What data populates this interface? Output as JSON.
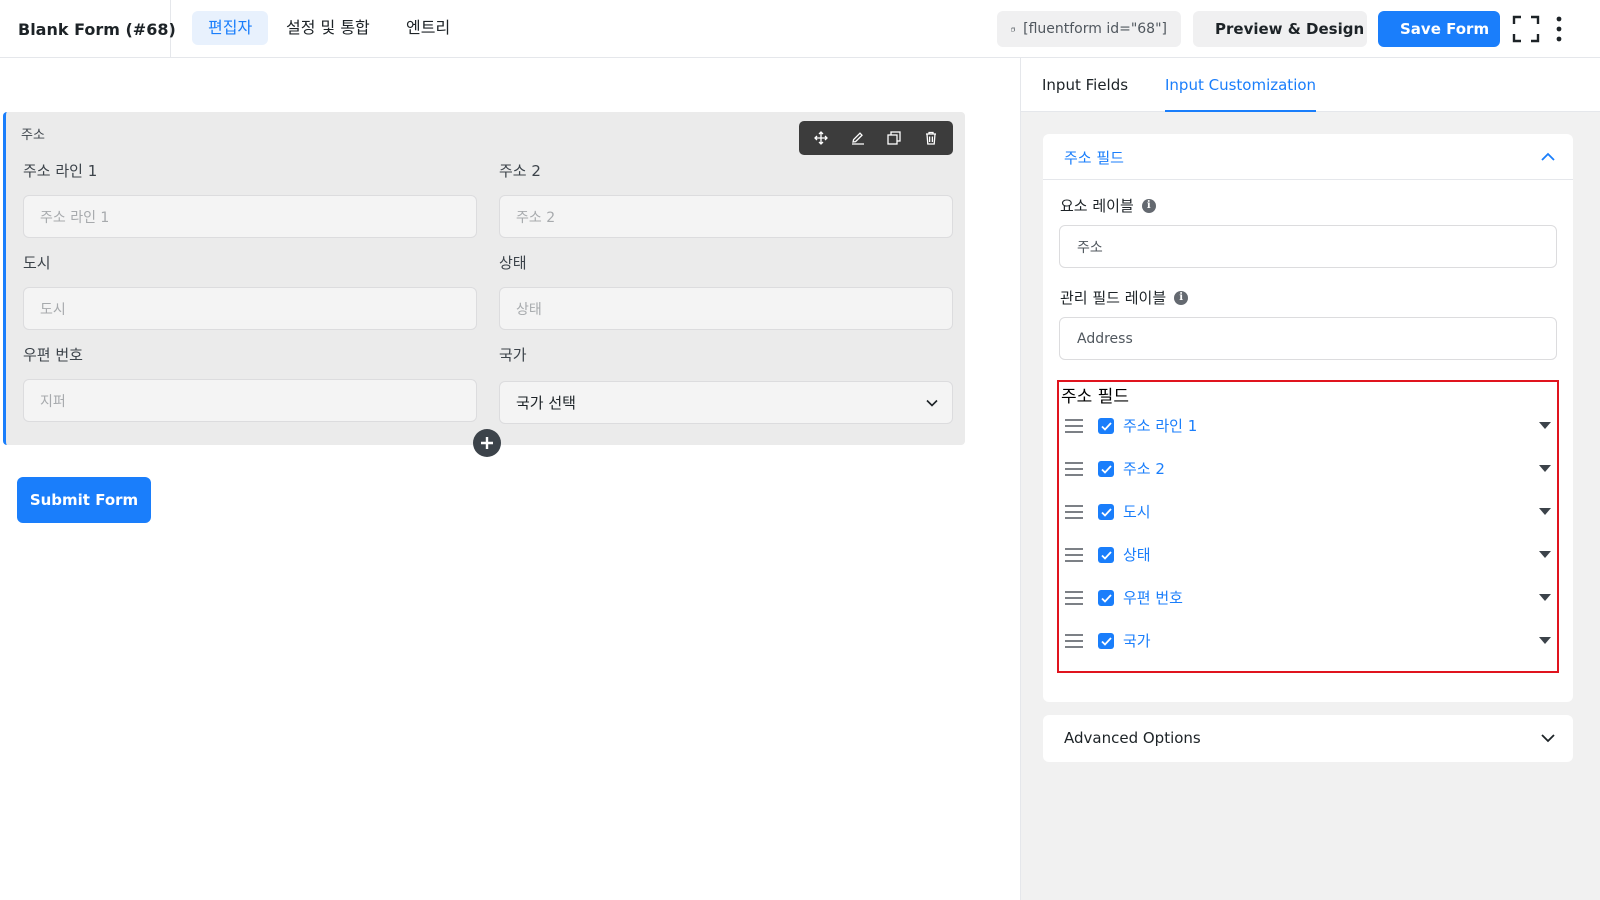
{
  "header": {
    "form_title": "Blank Form (#68)",
    "tabs": [
      "편집자",
      "설정 및 통합",
      "엔트리"
    ],
    "shortcode": "[fluentform id=\"68\"]",
    "preview_label": "Preview & Design",
    "save_label": "Save Form"
  },
  "editor": {
    "field_title": "주소",
    "fields": [
      {
        "label": "주소 라인 1",
        "placeholder": "주소 라인 1"
      },
      {
        "label": "주소 2",
        "placeholder": "주소 2"
      },
      {
        "label": "도시",
        "placeholder": "도시"
      },
      {
        "label": "상태",
        "placeholder": "상태"
      },
      {
        "label": "우편 번호",
        "placeholder": "지퍼"
      },
      {
        "label": "국가",
        "selected": "국가 선택"
      }
    ],
    "submit_label": "Submit Form"
  },
  "sidebar": {
    "tabs": [
      "Input Fields",
      "Input Customization"
    ],
    "panel_title": "주소 필드",
    "element_label_caption": "요소 레이블",
    "element_label_value": "주소",
    "admin_label_caption": "관리 필드 레이블",
    "admin_label_value": "Address",
    "address_fields_title": "주소 필드",
    "address_fields": [
      "주소 라인 1",
      "주소 2",
      "도시",
      "상태",
      "우편 번호",
      "국가"
    ],
    "advanced_label": "Advanced Options"
  },
  "colors": {
    "accent": "#1a7efb",
    "highlight_border": "#e0141e"
  }
}
